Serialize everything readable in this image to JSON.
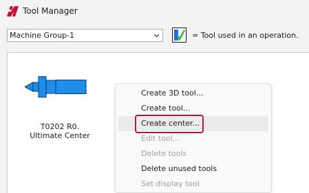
{
  "window": {
    "title": "Tool Manager"
  },
  "toolbar": {
    "group_select_value": "Machine Group-1",
    "legend_text": "= Tool used in an operation."
  },
  "tool": {
    "label_line1": "T0202 R0.",
    "label_line2": "Ultimate Center",
    "color": "#1e8ee8"
  },
  "context_menu": {
    "items": [
      {
        "label": "Create 3D tool...",
        "enabled": true
      },
      {
        "label": "Create tool...",
        "enabled": true
      },
      {
        "label": "Create center...",
        "enabled": true
      },
      {
        "label": "Edit tool...",
        "enabled": false
      },
      {
        "label": "Delete tools",
        "enabled": false
      },
      {
        "label": "Delete unused tools",
        "enabled": true
      },
      {
        "label": "Set display tool",
        "enabled": false
      }
    ]
  },
  "colors": {
    "highlight": "#b0174e",
    "disabled_text": "#a0a0a0",
    "logo_red": "#c8102e"
  }
}
